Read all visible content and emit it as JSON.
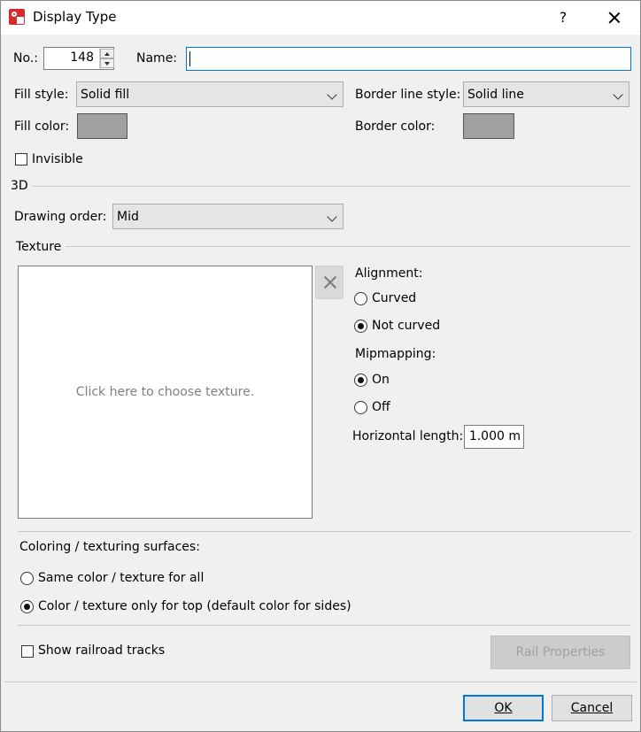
{
  "window": {
    "title": "Display Type",
    "help_label": "?"
  },
  "general": {
    "no_label": "No.:",
    "no_value": "148",
    "name_label": "Name:",
    "name_value": "",
    "fill_style_label": "Fill style:",
    "fill_style_value": "Solid fill",
    "border_line_style_label": "Border line style:",
    "border_line_style_value": "Solid line",
    "fill_color_label": "Fill color:",
    "border_color_label": "Border color:",
    "fill_color": "#a0a0a0",
    "border_color": "#a0a0a0",
    "invisible_label": "Invisible",
    "invisible_checked": false
  },
  "section_3d": {
    "label": "3D",
    "drawing_order_label": "Drawing order:",
    "drawing_order_value": "Mid"
  },
  "texture": {
    "label": "Texture",
    "placeholder": "Click here to choose texture.",
    "alignment_label": "Alignment:",
    "alignment_options": [
      "Curved",
      "Not curved"
    ],
    "alignment_selected": "Not curved",
    "mipmapping_label": "Mipmapping:",
    "mipmapping_options": [
      "On",
      "Off"
    ],
    "mipmapping_selected": "On",
    "horizontal_length_label": "Horizontal length:",
    "horizontal_length_value": "1.000 m"
  },
  "surfaces": {
    "label": "Coloring / texturing surfaces:",
    "options": [
      "Same color / texture for all",
      "Color / texture only for top (default color for sides)"
    ],
    "selected": "Color / texture only for top (default color for sides)"
  },
  "rail": {
    "show_tracks_label": "Show railroad tracks",
    "show_tracks_checked": false,
    "properties_button": "Rail Properties"
  },
  "footer": {
    "ok_label": "OK",
    "cancel_label": "Cancel"
  },
  "colors": {
    "accent": "#0078d7",
    "dialog_bg": "#f0f0f0",
    "app_icon": "#d62b2b"
  }
}
